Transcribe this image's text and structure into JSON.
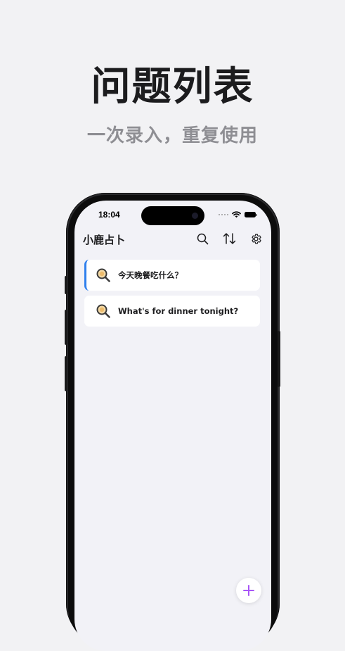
{
  "promo": {
    "headline": "问题列表",
    "subline": "一次录入，重复使用"
  },
  "status_bar": {
    "time": "18:04"
  },
  "app": {
    "title": "小鹿占卜",
    "toolbar": {
      "search_icon": "search-icon",
      "sort_icon": "sort-icon",
      "settings_icon": "gear-icon"
    }
  },
  "questions": [
    {
      "text": "今天晚餐吃什么？",
      "icon": "magnifier-icon",
      "selected": true
    },
    {
      "text": "What's for dinner tonight?",
      "icon": "magnifier-icon",
      "selected": false
    }
  ],
  "fab": {
    "icon": "plus-icon"
  },
  "colors": {
    "background": "#f2f2f4",
    "accent_selected": "#2f80ed",
    "fab_plus": "#a855f7"
  }
}
